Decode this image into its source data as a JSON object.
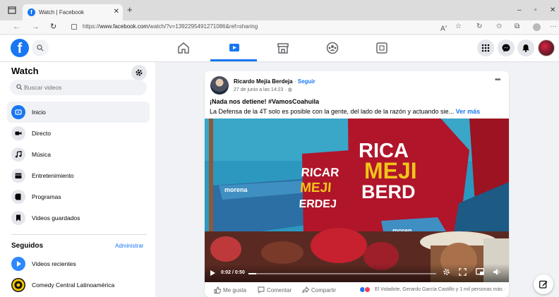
{
  "browser": {
    "tab_title": "Watch | Facebook",
    "new_tab": "+",
    "url_prefix": "https://",
    "url_host": "www.facebook.com",
    "url_path": "/watch/?v=1392295491271086&ref=sharing",
    "reader_label": "A",
    "window_controls": [
      "–",
      "▫",
      "✕"
    ]
  },
  "header": {
    "logo_letter": "f",
    "nav_tabs": [
      {
        "name": "home-icon",
        "active": false
      },
      {
        "name": "watch-icon",
        "active": true
      },
      {
        "name": "marketplace-icon",
        "active": false
      },
      {
        "name": "groups-icon",
        "active": false
      },
      {
        "name": "gaming-icon",
        "active": false
      }
    ]
  },
  "sidebar": {
    "title": "Watch",
    "search_placeholder": "Buscar videos",
    "items": [
      {
        "label": "Inicio",
        "icon": "home-video-icon",
        "active": true
      },
      {
        "label": "Directo",
        "icon": "live-icon"
      },
      {
        "label": "Música",
        "icon": "music-icon"
      },
      {
        "label": "Entretenimiento",
        "icon": "entertainment-icon"
      },
      {
        "label": "Programas",
        "icon": "shows-icon"
      },
      {
        "label": "Videos guardados",
        "icon": "saved-icon"
      }
    ],
    "following_title": "Seguidos",
    "admin_link": "Administrar",
    "following": [
      {
        "label": "Videos recientes",
        "icon": "recent-videos-icon",
        "color": "#2d88ff"
      },
      {
        "label": "Comedy Central Latinoamérica",
        "icon": "comedy-central-icon",
        "color": "#f6c500"
      }
    ]
  },
  "post": {
    "author": "Ricardo Mejía Berdeja",
    "separator": "·",
    "follow": "Seguir",
    "date": "27 de junio a las 14:23 · ",
    "headline": "¡Nada nos detiene! #VamosCoahuila",
    "body": "La Defensa de la 4T solo es posible con la gente, del lado de la razón y actuando sie... ",
    "see_more": "Ver más",
    "video": {
      "time": "0:02 / 0:50",
      "progress": 0.04,
      "banner_line1": "RICA",
      "banner_line2": "MEJI",
      "banner_line3": "BERD",
      "left_line1": "RICAR",
      "left_line2": "MEJI",
      "left_line3": "ERDEJ",
      "morena_left": "morena",
      "morena_right": "moren"
    },
    "actions": {
      "like": "Me gusta",
      "comment": "Comentar",
      "share": "Compartir"
    },
    "reactions_text": "El Voladote, Gerardo García Castillo y 1 mil personas más",
    "reactions_sep": " ·"
  },
  "colors": {
    "accent": "#1877f2",
    "banner_red": "#b0152a",
    "banner_yellow": "#f0c419"
  }
}
